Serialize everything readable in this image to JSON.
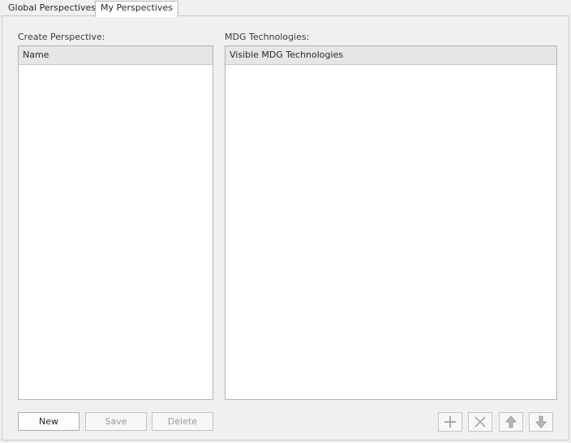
{
  "tabs": [
    {
      "label": "Global Perspectives",
      "active": false
    },
    {
      "label": "My Perspectives",
      "active": true
    }
  ],
  "create_perspective": {
    "label": "Create Perspective:",
    "column_header": "Name",
    "items": []
  },
  "mdg_technologies": {
    "label": "MDG Technologies:",
    "column_header": "Visible MDG Technologies",
    "items": []
  },
  "buttons": {
    "new_label": "New",
    "save_label": "Save",
    "delete_label": "Delete"
  },
  "icons": {
    "add": "plus-icon",
    "remove": "cross-icon",
    "move_up": "arrow-up-icon",
    "move_down": "arrow-down-icon"
  },
  "colors": {
    "background": "#f0f0f0",
    "list_background": "#ffffff",
    "header_background": "#e6e6e6",
    "disabled_text": "#9a9a9a"
  }
}
